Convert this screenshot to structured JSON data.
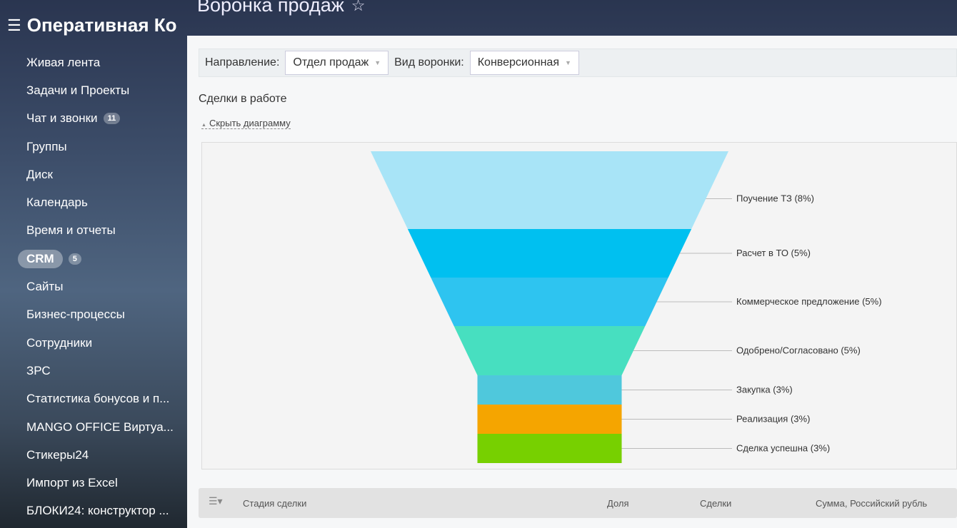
{
  "header": {
    "title": "Воронка продаж",
    "portal": "Оперативная Ко"
  },
  "sidebar": {
    "items": [
      {
        "label": "Живая лента"
      },
      {
        "label": "Задачи и Проекты"
      },
      {
        "label": "Чат и звонки",
        "badge": "11"
      },
      {
        "label": "Группы"
      },
      {
        "label": "Диск"
      },
      {
        "label": "Календарь"
      },
      {
        "label": "Время и отчеты"
      },
      {
        "label": "CRM",
        "badge": "5",
        "active": true
      },
      {
        "label": "Сайты"
      },
      {
        "label": "Бизнес-процессы"
      },
      {
        "label": "Сотрудники"
      },
      {
        "label": "ЗРС"
      },
      {
        "label": "Статистика бонусов и п..."
      },
      {
        "label": "MANGO OFFICE Виртуа..."
      },
      {
        "label": "Стикеры24"
      },
      {
        "label": "Импорт из Excel"
      },
      {
        "label": "БЛОКИ24: конструктор ..."
      }
    ]
  },
  "filters": {
    "direction_label": "Направление:",
    "direction_value": "Отдел продаж",
    "type_label": "Вид воронки:",
    "type_value": "Конверсионная"
  },
  "section": {
    "title": "Сделки в работе",
    "toggle": "Скрыть диаграмму"
  },
  "table": {
    "columns": [
      "Стадия сделки",
      "Доля",
      "Сделки",
      "Сумма, Российский рубль"
    ]
  },
  "chart_data": {
    "type": "funnel",
    "stages": [
      {
        "label": "Поучение ТЗ (8%)",
        "value": 8,
        "color": "#a8e4f7"
      },
      {
        "label": "Расчет в ТО (5%)",
        "value": 5,
        "color": "#00c0f0"
      },
      {
        "label": "Коммерческое предложение (5%)",
        "value": 5,
        "color": "#2ec4f0"
      },
      {
        "label": "Одобрено/Согласовано (5%)",
        "value": 5,
        "color": "#47dfc0"
      },
      {
        "label": "Закупка (3%)",
        "value": 3,
        "color": "#4fc8dc"
      },
      {
        "label": "Реализация (3%)",
        "value": 3,
        "color": "#f5a500"
      },
      {
        "label": "Сделка успешна (3%)",
        "value": 3,
        "color": "#77d000"
      }
    ]
  }
}
